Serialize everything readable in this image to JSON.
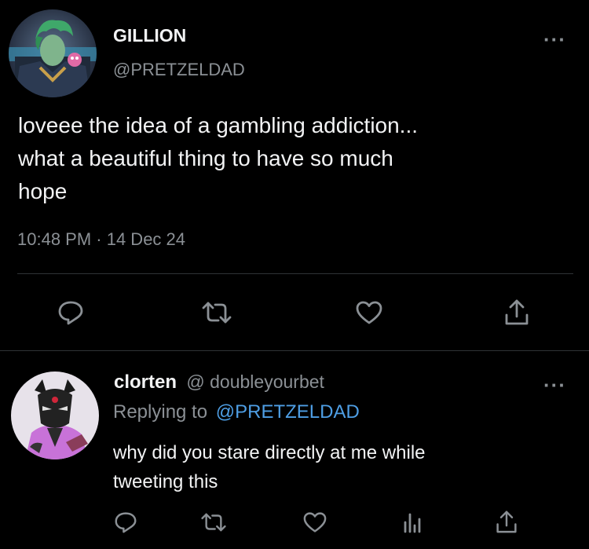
{
  "main_tweet": {
    "author_name": "GILLION",
    "author_handle": "@PRETZELDAD",
    "more_glyph": "···",
    "text_lines": [
      "loveee the idea of a gambling addiction...",
      "what a beautiful thing to have so much",
      "hope"
    ],
    "timestamp": "10:48 PM · 14 Dec 24",
    "actions": [
      "reply-icon",
      "retweet-icon",
      "like-icon",
      "share-icon"
    ]
  },
  "reply_tweet": {
    "author_name": "clorten",
    "author_handle": "@ doubleyourbet",
    "replying_prefix": "Replying to",
    "replying_to": "@PRETZELDAD",
    "more_glyph": "···",
    "text_lines": [
      "why did you stare directly at me while",
      "tweeting this"
    ],
    "actions": [
      "reply-icon",
      "retweet-icon",
      "like-icon",
      "analytics-icon",
      "share-icon"
    ]
  },
  "colors": {
    "background": "#000000",
    "text": "#e7e9ea",
    "secondary": "#8b9095",
    "link": "#4e9ee4",
    "divider": "#2f3336"
  }
}
